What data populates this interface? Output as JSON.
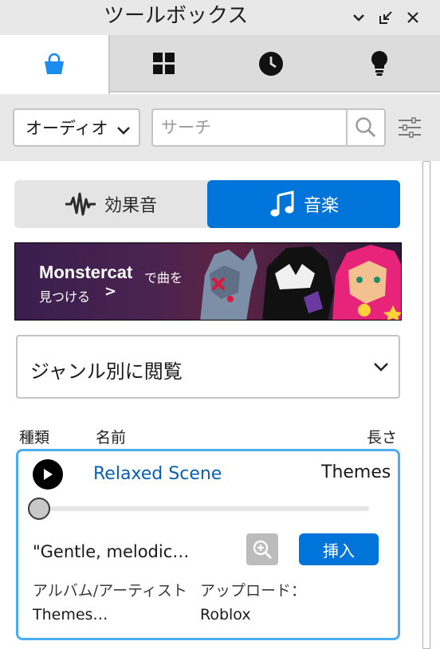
{
  "window": {
    "title": "ツールボックス",
    "controls": [
      "chevron-down-icon",
      "restore-icon",
      "close-icon"
    ]
  },
  "tabs": [
    {
      "icon": "shopping-bag-icon",
      "active": true
    },
    {
      "icon": "grid-icon",
      "active": false
    },
    {
      "icon": "clock-icon",
      "active": false
    },
    {
      "icon": "lightbulb-icon",
      "active": false
    }
  ],
  "filters": {
    "category": "オーディオ",
    "search_placeholder": "サーチ"
  },
  "toggle": {
    "sound_effects": "効果音",
    "music": "音楽",
    "selected": "music"
  },
  "banner": {
    "brand": "Monstercat",
    "suffix": "で曲を",
    "line2": "見つける",
    "arrow": ">"
  },
  "genre": {
    "label": "ジャンル別に閲覧"
  },
  "columns": {
    "type": "種類",
    "name": "名前",
    "length": "長さ"
  },
  "track": {
    "name": "Relaxed Scene",
    "creator": "Themes Inte",
    "description": "\"Gentle, melodic…",
    "insert_label": "挿入",
    "album_label": "アルバム/アーティスト",
    "upload_label": "アップロード：",
    "album_value": "Themes…",
    "upload_value": "Roblox",
    "progress": 0
  },
  "colors": {
    "accent": "#0074d9",
    "selection_border": "#4aaef0",
    "link": "#0a5fb3"
  }
}
